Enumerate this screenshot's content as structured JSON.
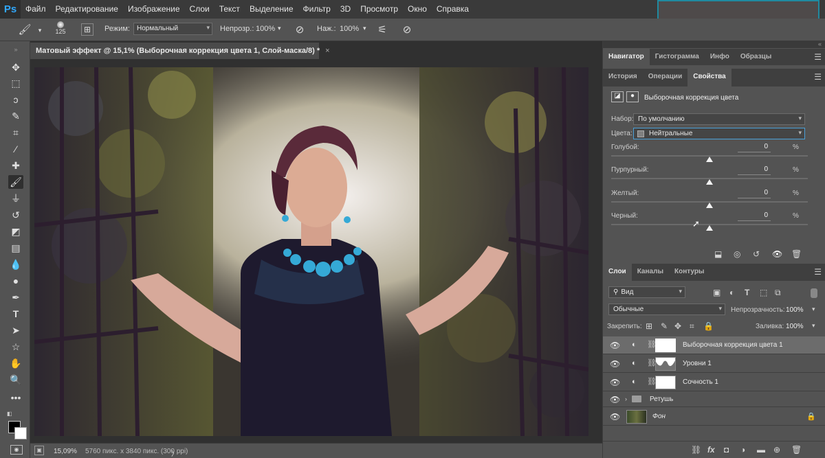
{
  "app": {
    "logo": "Ps"
  },
  "menu": [
    "Файл",
    "Редактирование",
    "Изображение",
    "Слои",
    "Текст",
    "Выделение",
    "Фильтр",
    "3D",
    "Просмотр",
    "Окно",
    "Справка"
  ],
  "options": {
    "brush_size": "125",
    "mode_label": "Режим:",
    "mode_value": "Нормальный",
    "opacity_label": "Непрозр.:",
    "opacity_value": "100%",
    "flow_label": "Наж.:",
    "flow_value": "100%"
  },
  "document": {
    "tab_title": "Матовый эффект @ 15,1% (Выборочная коррекция цвета 1, Слой-маска/8) *",
    "close": "×",
    "zoom": "15,09%",
    "info": "5760 пикс. x 3840 пикс. (300 ppi)",
    "info_arrow": "〉"
  },
  "panels": {
    "top_tabs": [
      "Навигатор",
      "Гистограмма",
      "Инфо",
      "Образцы"
    ],
    "mid_tabs": [
      "История",
      "Операции",
      "Свойства"
    ],
    "properties": {
      "title": "Выборочная коррекция цвета",
      "preset_label": "Набор:",
      "preset_value": "По умолчанию",
      "colors_label": "Цвета:",
      "colors_value": "Нейтральные",
      "sliders": [
        {
          "label": "Голубой:",
          "value": "0",
          "unit": "%",
          "position": 0.5
        },
        {
          "label": "Пурпурный:",
          "value": "0",
          "unit": "%",
          "position": 0.5
        },
        {
          "label": "Желтый:",
          "value": "0",
          "unit": "%",
          "position": 0.5
        },
        {
          "label": "Черный:",
          "value": "0",
          "unit": "%",
          "position": 0.5
        }
      ]
    },
    "layer_tabs": [
      "Слои",
      "Каналы",
      "Контуры"
    ],
    "layers_panel": {
      "filter_value": "Вид",
      "blend_value": "Обычные",
      "opacity_label": "Непрозрачность:",
      "opacity_value": "100%",
      "lock_label": "Закрепить:",
      "fill_label": "Заливка:",
      "fill_value": "100%"
    },
    "layers": [
      {
        "name": "Выборочная коррекция цвета 1",
        "selected": true
      },
      {
        "name": "Уровни 1",
        "selected": false
      },
      {
        "name": "Сочность 1",
        "selected": false
      },
      {
        "name": "Ретушь",
        "selected": false
      },
      {
        "name": "Фон",
        "selected": false
      }
    ]
  },
  "colors": {
    "accent": "#31a8ff",
    "selection": "#1f8aa0"
  }
}
